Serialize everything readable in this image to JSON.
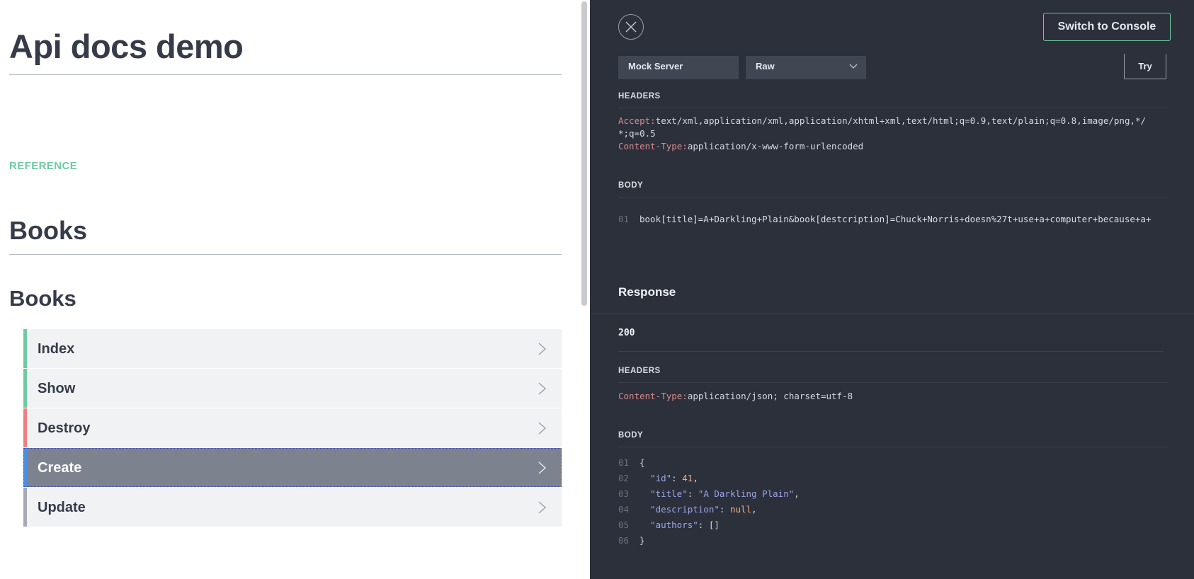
{
  "left": {
    "title": "Api docs demo",
    "reference_label": "REFERENCE",
    "section_heading": "Books",
    "group_heading": "Books",
    "endpoints": [
      {
        "label": "Index"
      },
      {
        "label": "Show"
      },
      {
        "label": "Destroy"
      },
      {
        "label": "Create"
      },
      {
        "label": "Update"
      }
    ]
  },
  "right": {
    "switch_console_label": "Switch to Console",
    "server_select": "Mock Server",
    "format_select": "Raw",
    "try_label": "Try",
    "request": {
      "headers_label": "HEADERS",
      "headers": [
        {
          "key": "Accept:",
          "value": "text/xml,application/xml,application/xhtml+xml,text/html;q=0.9,text/plain;q=0.8,image/png,*/"
        },
        {
          "key": "",
          "value": "*;q=0.5"
        },
        {
          "key": "Content-Type:",
          "value": "application/x-www-form-urlencoded"
        }
      ],
      "body_label": "BODY",
      "body_lines": [
        {
          "num": "01",
          "text": "book[title]=A+Darkling+Plain&book[destcription]=Chuck+Norris+doesn%27t+use+a+computer+because+a+"
        }
      ]
    },
    "response": {
      "title": "Response",
      "status": "200",
      "headers_label": "HEADERS",
      "headers": [
        {
          "key": "Content-Type:",
          "value": "application/json; charset=utf-8"
        }
      ],
      "body_label": "BODY",
      "body_lines": [
        {
          "num": "01",
          "parts": [
            {
              "t": "{",
              "c": "jpunc"
            }
          ]
        },
        {
          "num": "02",
          "parts": [
            {
              "t": "  \"id\"",
              "c": "jkey"
            },
            {
              "t": ": ",
              "c": "jpunc"
            },
            {
              "t": "41",
              "c": "jnum"
            },
            {
              "t": ",",
              "c": "jpunc"
            }
          ]
        },
        {
          "num": "03",
          "parts": [
            {
              "t": "  \"title\"",
              "c": "jkey"
            },
            {
              "t": ": ",
              "c": "jpunc"
            },
            {
              "t": "\"A Darkling Plain\"",
              "c": "jstr"
            },
            {
              "t": ",",
              "c": "jpunc"
            }
          ]
        },
        {
          "num": "04",
          "parts": [
            {
              "t": "  \"description\"",
              "c": "jkey"
            },
            {
              "t": ": ",
              "c": "jpunc"
            },
            {
              "t": "null",
              "c": "jnull"
            },
            {
              "t": ",",
              "c": "jpunc"
            }
          ]
        },
        {
          "num": "05",
          "parts": [
            {
              "t": "  \"authors\"",
              "c": "jkey"
            },
            {
              "t": ": []",
              "c": "jpunc"
            }
          ]
        },
        {
          "num": "06",
          "parts": [
            {
              "t": "}",
              "c": "jpunc"
            }
          ]
        }
      ]
    }
  }
}
